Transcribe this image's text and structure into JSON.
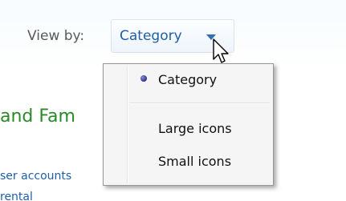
{
  "toolbar": {
    "view_by_label": "View by:",
    "view_by_value": "Category"
  },
  "background": {
    "heading_partial": "and Fam",
    "link_partial": "ser accounts",
    "link2_partial": "rental"
  },
  "menu": {
    "selected": "Category",
    "items": [
      {
        "label": "Category",
        "selected": true
      },
      {
        "label": "Large icons",
        "selected": false
      },
      {
        "label": "Small icons",
        "selected": false
      }
    ]
  },
  "colors": {
    "link_blue": "#1e5fa8",
    "heading_green": "#2a8a2a"
  },
  "icons": {
    "dropdown": "chevron-down-icon",
    "cursor": "mouse-pointer-icon",
    "bullet": "radio-bullet-icon"
  }
}
